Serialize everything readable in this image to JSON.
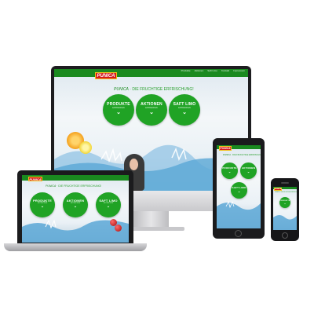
{
  "site": {
    "logo": "PUNICA",
    "brand": "PUNICA",
    "tagline": "· DIE FRUCHTIGE ERFRISCHUNG!",
    "nav": [
      "Produkte",
      "Aktionen",
      "Saft Limo",
      "Kontakt",
      "Impressum"
    ],
    "circles": [
      {
        "title": "PRODUKTE",
        "sub": "ENTDECKEN",
        "chevron": "⌄"
      },
      {
        "title": "AKTIONEN",
        "sub": "ENTDECKEN",
        "chevron": "⌄"
      },
      {
        "title": "SAFT LIMO",
        "sub": "ENTDECKEN",
        "chevron": "⌄"
      }
    ]
  },
  "colors": {
    "brand_green": "#1a8a1f",
    "circle_green": "#20a325",
    "logo_red": "#d61b1b",
    "water_blue": "#5aa7d6"
  }
}
